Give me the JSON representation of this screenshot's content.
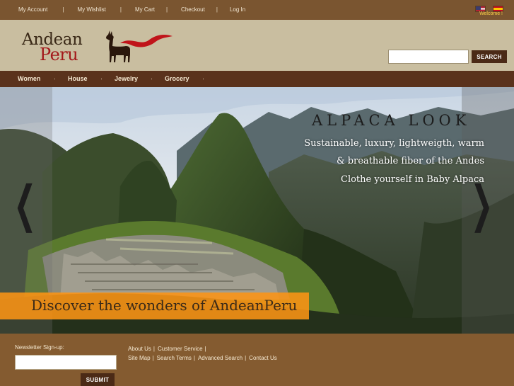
{
  "topbar": {
    "links": [
      {
        "label": "My Account"
      },
      {
        "label": "My Wishlist"
      },
      {
        "label": "My Cart"
      },
      {
        "label": "Checkout"
      },
      {
        "label": "Log In"
      }
    ],
    "separator": "|",
    "welcome": "Welcome !",
    "flags": [
      "us-flag-icon",
      "es-flag-icon"
    ]
  },
  "header": {
    "logo_line1": "Andean",
    "logo_line2": "Peru",
    "search_placeholder": "",
    "search_button": "SEARCH"
  },
  "nav": {
    "items": [
      {
        "label": "Women"
      },
      {
        "label": "House"
      },
      {
        "label": "Jewelry"
      },
      {
        "label": "Grocery"
      }
    ],
    "separator": "·"
  },
  "banner": {
    "headline": "ALPACA LOOK",
    "lines": [
      "Sustainable, luxury, lightweigth, warm",
      "& breathable fiber of the Andes",
      "Clothe yourself in Baby Alpaca"
    ],
    "caption": "Discover the wonders of AndeanPeru",
    "prev_icon": "chevron-left-icon",
    "next_icon": "chevron-right-icon"
  },
  "footer": {
    "newsletter_label": "Newsletter Sign-up:",
    "newsletter_placeholder": "",
    "submit_button": "SUBMIT",
    "links_row1": [
      {
        "label": "About Us"
      },
      {
        "label": "Customer Service"
      }
    ],
    "links_row2": [
      {
        "label": "Site Map"
      },
      {
        "label": "Search Terms"
      },
      {
        "label": "Advanced Search"
      },
      {
        "label": "Contact Us"
      }
    ],
    "separator": "|"
  },
  "colors": {
    "topbar": "#7a5530",
    "header": "#c9bea0",
    "nav": "#5a321c",
    "button": "#4b2a16",
    "caption_strip": "#fc9414",
    "logo_red": "#a3181a"
  }
}
